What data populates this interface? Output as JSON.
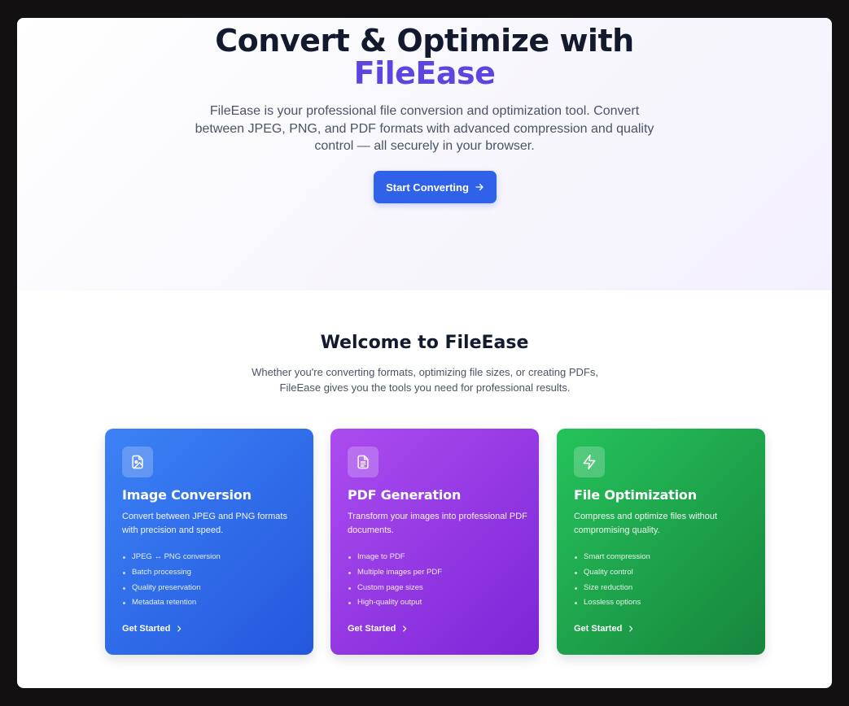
{
  "hero": {
    "title_line1": "Convert & Optimize with",
    "title_brand": "FileEase",
    "subtitle": "FileEase is your professional file conversion and optimization tool. Convert between JPEG, PNG, and PDF formats with advanced compression and quality control — all securely in your browser.",
    "cta_label": "Start Converting",
    "cta_icon": "arrow-right-icon"
  },
  "welcome": {
    "title": "Welcome to FileEase",
    "subtitle": "Whether you're converting formats, optimizing file sizes, or creating PDFs, FileEase gives you the tools you need for professional results."
  },
  "cards": [
    {
      "icon": "image-file-icon",
      "title": "Image Conversion",
      "description": "Convert between JPEG and PNG formats with precision and speed.",
      "features": [
        "JPEG ↔ PNG conversion",
        "Batch processing",
        "Quality preservation",
        "Metadata retention"
      ],
      "link": "Get Started",
      "color": "#2f6bea"
    },
    {
      "icon": "document-icon",
      "title": "PDF Generation",
      "description": "Transform your images into professional PDF documents.",
      "features": [
        "Image to PDF",
        "Multiple images per PDF",
        "Custom page sizes",
        "High-quality output"
      ],
      "link": "Get Started",
      "color": "#9538e6"
    },
    {
      "icon": "lightning-icon",
      "title": "File Optimization",
      "description": "Compress and optimize files without compromising quality.",
      "features": [
        "Smart compression",
        "Quality control",
        "Size reduction",
        "Lossless options"
      ],
      "link": "Get Started",
      "color": "#1fa44c"
    }
  ],
  "colors": {
    "brand": "#5b47e0",
    "primary_button": "#2f62e8",
    "heading": "#141a2e"
  }
}
